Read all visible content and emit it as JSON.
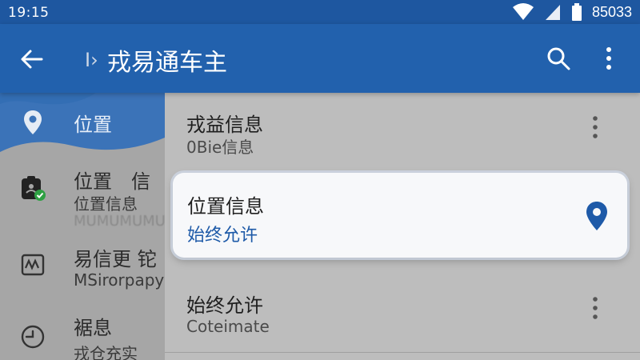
{
  "status_bar": {
    "time": "19:15",
    "battery_text": "85033"
  },
  "app_bar": {
    "caret": "I›",
    "title": "戎易通车主"
  },
  "drawer": {
    "items": [
      {
        "label": "位置",
        "icon": "location-pin-icon"
      },
      {
        "label": "位置　信",
        "sublabel": "位置信息",
        "extra": "MUMUMUMU",
        "icon": "id-badge-check-icon"
      },
      {
        "label": "易信更 铊",
        "sublabel": "MSirorpapy",
        "icon": "activity-chart-icon"
      },
      {
        "label": "裾息",
        "sublabel": "戎仓充实",
        "icon": "clock-icon"
      }
    ]
  },
  "list": {
    "items": [
      {
        "primary": "戎益信息",
        "secondary": "0Bie信息"
      },
      {
        "primary": "位置信息",
        "secondary": "始终允许",
        "highlighted": true
      },
      {
        "primary": "始终允许",
        "secondary": "Coteimate"
      }
    ]
  },
  "colors": {
    "app_bar": "#2261ad",
    "status_bar": "#1e57a0",
    "accent": "#1e5aa8",
    "card": "#f7f8fa"
  }
}
